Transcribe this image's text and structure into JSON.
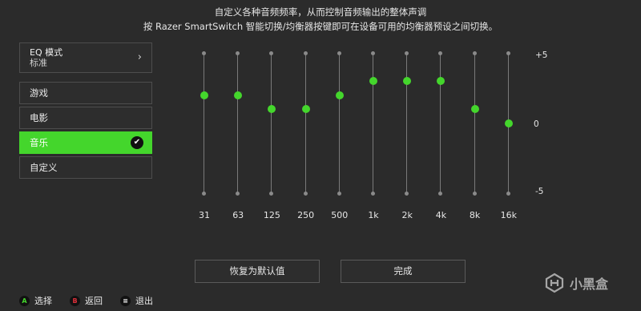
{
  "header": {
    "line1": "自定义各种音频频率，从而控制音频输出的整体声调",
    "line2": "按 Razer SmartSwitch 智能切换/均衡器按键即可在设备可用的均衡器预设之间切换。"
  },
  "eq_mode": {
    "title": "EQ 模式",
    "value": "标准",
    "chevron_icon": "chevron-right-icon"
  },
  "presets": [
    {
      "label": "游戏",
      "active": false
    },
    {
      "label": "电影",
      "active": false
    },
    {
      "label": "音乐",
      "active": true
    },
    {
      "label": "自定义",
      "active": false
    }
  ],
  "check_icon": "checkmark-icon",
  "scale": {
    "max": "+5",
    "mid": "0",
    "min": "-5"
  },
  "bands": [
    {
      "label": "31",
      "gain": 2
    },
    {
      "label": "63",
      "gain": 2
    },
    {
      "label": "125",
      "gain": 1
    },
    {
      "label": "250",
      "gain": 1
    },
    {
      "label": "500",
      "gain": 2
    },
    {
      "label": "1k",
      "gain": 3
    },
    {
      "label": "2k",
      "gain": 3
    },
    {
      "label": "4k",
      "gain": 3
    },
    {
      "label": "8k",
      "gain": 1
    },
    {
      "label": "16k",
      "gain": 0
    }
  ],
  "buttons": {
    "reset": "恢复为默认值",
    "done": "完成"
  },
  "footer": [
    {
      "key": "A",
      "label": "选择",
      "color": "#44d62c"
    },
    {
      "key": "B",
      "label": "返回",
      "color": "#e0303a"
    },
    {
      "key": "≡",
      "label": "退出",
      "color": "#e8e8e8"
    }
  ],
  "watermark": "小黑盒",
  "colors": {
    "accent": "#44d62c",
    "background": "#2b2b2b"
  }
}
